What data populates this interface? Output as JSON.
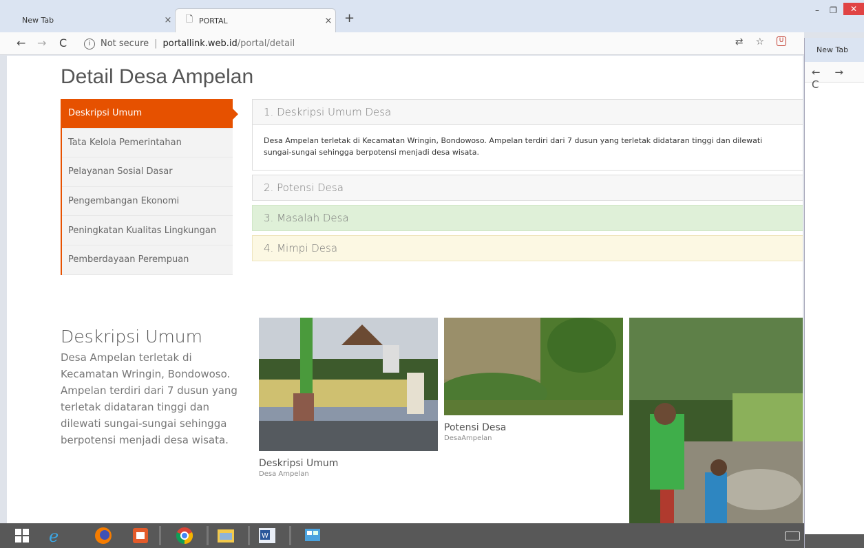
{
  "browser": {
    "tabs": [
      {
        "label": "New Tab",
        "close": "×"
      },
      {
        "label": "PORTAL",
        "close": "×"
      }
    ],
    "new_tab": "+",
    "window_controls": {
      "minimize": "–",
      "maximize": "❐",
      "close": "✕"
    },
    "nav": {
      "back": "←",
      "forward": "→",
      "reload": "C"
    },
    "address": {
      "security": "Not secure",
      "separator": "|",
      "host": "portallink.web.id",
      "path": "/portal/detail"
    },
    "toolbar_icons": [
      "translate-icon",
      "star-icon",
      "extension-icon"
    ]
  },
  "page": {
    "title": "Detail Desa Ampelan",
    "menu": [
      {
        "label": "Deskripsi Umum",
        "active": true
      },
      {
        "label": "Tata Kelola Pemerintahan"
      },
      {
        "label": "Pelayanan Sosial Dasar"
      },
      {
        "label": "Pengembangan Ekonomi"
      },
      {
        "label": "Peningkatan Kualitas Lingkungan"
      },
      {
        "label": "Pemberdayaan Perempuan"
      }
    ],
    "accordion": [
      {
        "title": "1. Deskripsi Umum Desa",
        "body": "Desa Ampelan terletak di Kecamatan Wringin, Bondowoso. Ampelan terdiri dari 7 dusun yang terletak didataran tinggi dan dilewati sungai-sungai sehingga berpotensi menjadi desa wisata."
      },
      {
        "title": "2. Potensi Desa"
      },
      {
        "title": "3. Masalah Desa"
      },
      {
        "title": "4. Mimpi Desa"
      }
    ],
    "description": {
      "title": "Deskripsi Umum",
      "text": "Desa Ampelan terletak di Kecamatan Wringin, Bondowoso. Ampelan terdiri dari 7 dusun yang terletak didataran tinggi dan dilewati sungai-sungai sehingga berpotensi menjadi desa wisata."
    },
    "gallery": [
      {
        "title": "Deskripsi Umum",
        "subtitle": "Desa Ampelan"
      },
      {
        "title": "Potensi Desa",
        "subtitle": "DesaAmpelan"
      },
      {
        "title": "",
        "subtitle": ""
      }
    ]
  },
  "second_window": {
    "tab_label": "New Tab",
    "nav": "← → C"
  },
  "colors": {
    "accent": "#e65100",
    "success_bg": "#dff0d8",
    "warning_bg": "#fcf8e3"
  },
  "taskbar": {
    "icons": [
      "windows-start-icon",
      "internet-explorer-icon",
      "firefox-icon",
      "presentation-icon",
      "chrome-icon",
      "file-manager-icon",
      "word-icon",
      "control-panel-icon",
      "keyboard-icon"
    ]
  }
}
